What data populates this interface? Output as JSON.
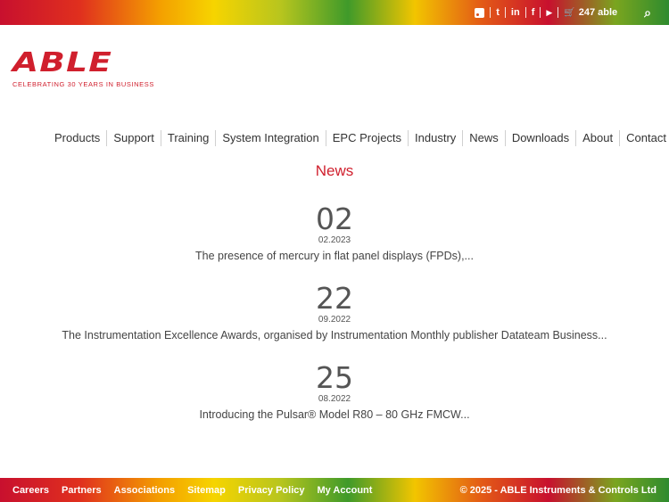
{
  "topbar": {
    "icons": [
      "rss-icon",
      "twitter-icon",
      "linkedin-icon",
      "facebook-icon",
      "youtube-icon",
      "cart-icon",
      "search-icon"
    ],
    "twitter_glyph": "t",
    "linkedin_glyph": "in",
    "facebook_glyph": "f",
    "youtube_glyph": "▶",
    "cart_glyph": "🛒",
    "cart_label": "247 able",
    "search_glyph": "⌕"
  },
  "logo": {
    "word": "ABLE",
    "tagline": "CELEBRATING 30 YEARS IN BUSINESS",
    "color": "#d01f2d"
  },
  "nav": {
    "items": [
      "Products",
      "Support",
      "Training",
      "System Integration",
      "EPC Projects",
      "Industry",
      "News",
      "Downloads",
      "About",
      "Contact"
    ]
  },
  "page": {
    "title": "News"
  },
  "news": [
    {
      "day": "02",
      "date": "02.2023",
      "text": "The presence of mercury in flat panel displays (FPDs),..."
    },
    {
      "day": "22",
      "date": "09.2022",
      "text": "The Instrumentation Excellence Awards, organised by Instrumentation Monthly publisher Datateam Business..."
    },
    {
      "day": "25",
      "date": "08.2022",
      "text": "Introducing the Pulsar® Model R80 – 80 GHz FMCW..."
    }
  ],
  "footer": {
    "links": [
      "Careers",
      "Partners",
      "Associations",
      "Sitemap",
      "Privacy Policy",
      "My Account"
    ],
    "copyright": "© 2025 - ABLE Instruments & Controls Ltd"
  },
  "colors": {
    "accent": "#d01f2d",
    "text": "#444444"
  }
}
